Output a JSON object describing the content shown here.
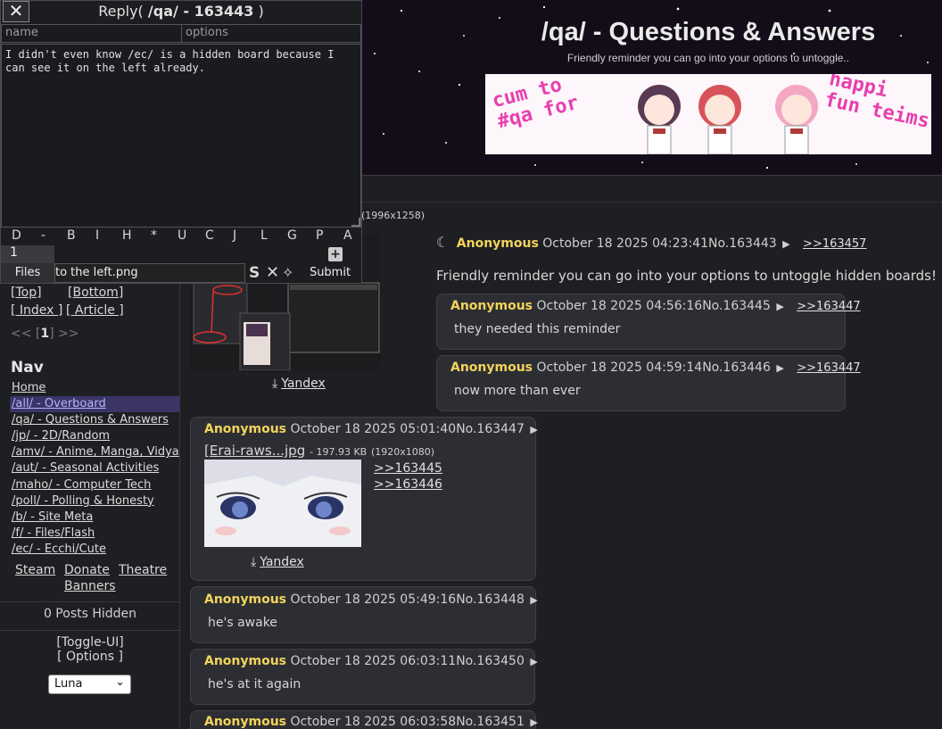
{
  "header": {
    "board_title": "/qa/ - Questions & Answers",
    "board_subtitle": "Friendly reminder you can go into your options to untoggle..",
    "banner_text_left": "cum to\n#qa for",
    "banner_text_right": "happi\nfun teims"
  },
  "reply_box": {
    "title_prefix": "Reply(",
    "title_board": "/qa/ - 163443",
    "title_suffix": ")",
    "name_placeholder": "name",
    "options_placeholder": "options",
    "message": "I didn't even know /ec/ is a hidden board because I\ncan see it on the left already.",
    "format_buttons": [
      "D",
      "-",
      "B",
      "I",
      "H",
      "*",
      "U",
      "C",
      "J",
      "L",
      "G",
      "P",
      "A"
    ],
    "captcha_value": "1",
    "files_label": "Files",
    "file_name": "to the left.png",
    "submit_label": "Submit"
  },
  "sidebar": {
    "top_link": "[Top]",
    "bottom_link": "[Bottom]",
    "index_link": "[ Index ]",
    "article_link": "[ Article ]",
    "pager_prev": "<<",
    "pager_current": "1",
    "pager_next": ">>",
    "nav_title": "Nav",
    "nav_items": [
      "Home",
      "/all/ - Overboard",
      "/qa/ - Questions & Answers",
      "/jp/ - 2D/Random",
      "/amv/ - Anime, Manga, Vidya",
      "/aut/ - Seasonal Activities",
      "/maho/ - Computer Tech",
      "/poll/ - Polling & Honesty",
      "/b/ - Site Meta",
      "/f/ - Files/Flash",
      "/ec/ - Ecchi/Cute"
    ],
    "extra_links": [
      "Steam",
      "Donate",
      "Theatre",
      "Banners"
    ],
    "posts_hidden": "0 Posts Hidden",
    "toggle_ui": "[Toggle-UI]",
    "options": "[ Options ]",
    "theme": "Luna"
  },
  "thread": {
    "op_file_meta": "(1996x1258)",
    "op_download": "Yandex",
    "op": {
      "name": "Anonymous",
      "date": "October 18 2025 04:23:41",
      "number": "No.163443",
      "backlink": ">>163457",
      "body": "Friendly reminder you can go into your options to untoggle hidden boards!"
    },
    "replies": [
      {
        "name": "Anonymous",
        "date": "October 18 2025 04:56:16",
        "number": "No.163445",
        "backlink": ">>163447",
        "body": "they needed this reminder"
      },
      {
        "name": "Anonymous",
        "date": "October 18 2025 04:59:14",
        "number": "No.163446",
        "backlink": ">>163447",
        "body": "now more than ever"
      },
      {
        "name": "Anonymous",
        "date": "October 18 2025 05:01:40",
        "number": "No.163447",
        "file_name": "[Erai-raws...jpg",
        "file_size": "- 197.93 KB",
        "file_dims": "(1920x1080)",
        "download": "Yandex",
        "quotes": [
          ">>163445",
          ">>163446"
        ]
      },
      {
        "name": "Anonymous",
        "date": "October 18 2025 05:49:16",
        "number": "No.163448",
        "body": "he's awake"
      },
      {
        "name": "Anonymous",
        "date": "October 18 2025 06:03:11",
        "number": "No.163450",
        "body": "he's at it again"
      },
      {
        "name": "Anonymous",
        "date": "October 18 2025 06:03:58",
        "number": "No.163451"
      }
    ]
  },
  "colors": {
    "background": "#1e1f22",
    "post_bg": "#2d2e33",
    "name": "#f2d45b",
    "selected_nav": "#b9b3ff",
    "banner_text": "#e83fae"
  }
}
